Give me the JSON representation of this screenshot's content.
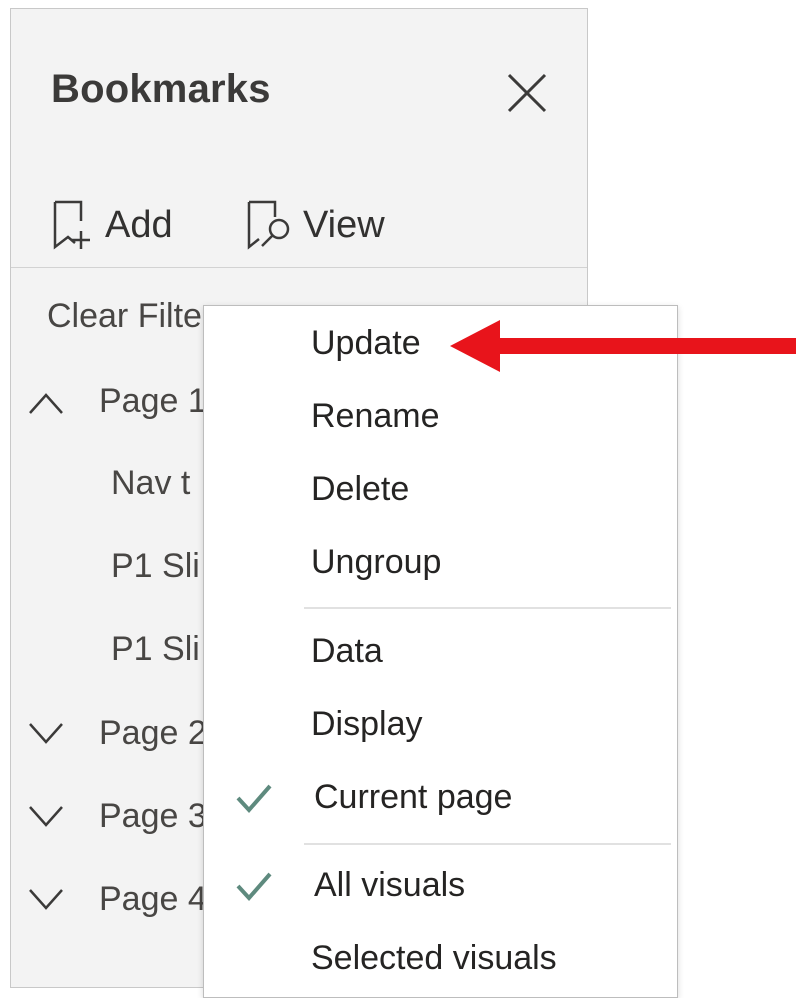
{
  "pane": {
    "title": "Bookmarks",
    "add_label": "Add",
    "view_label": "View",
    "clear_filter_label": "Clear Filte",
    "groups": [
      {
        "label": "Page 1",
        "expanded": true,
        "children": [
          "Nav t",
          "P1 Sli",
          "P1 Sli"
        ]
      },
      {
        "label": "Page 2",
        "expanded": false
      },
      {
        "label": "Page 3",
        "expanded": false
      },
      {
        "label": "Page 4",
        "expanded": false
      }
    ]
  },
  "context_menu": {
    "items": [
      {
        "label": "Update",
        "checked": false
      },
      {
        "label": "Rename",
        "checked": false
      },
      {
        "label": "Delete",
        "checked": false
      },
      {
        "label": "Ungroup",
        "checked": false
      },
      {
        "label": "Data",
        "checked": false
      },
      {
        "label": "Display",
        "checked": false
      },
      {
        "label": "Current page",
        "checked": true
      },
      {
        "label": "All visuals",
        "checked": true
      },
      {
        "label": "Selected visuals",
        "checked": false
      }
    ]
  },
  "annotation": {
    "arrow_color": "#e8141b",
    "points_to": "Update"
  },
  "colors": {
    "pane_bg": "#f3f3f3",
    "check": "#5e8a7e",
    "menu_bg": "#ffffff"
  }
}
